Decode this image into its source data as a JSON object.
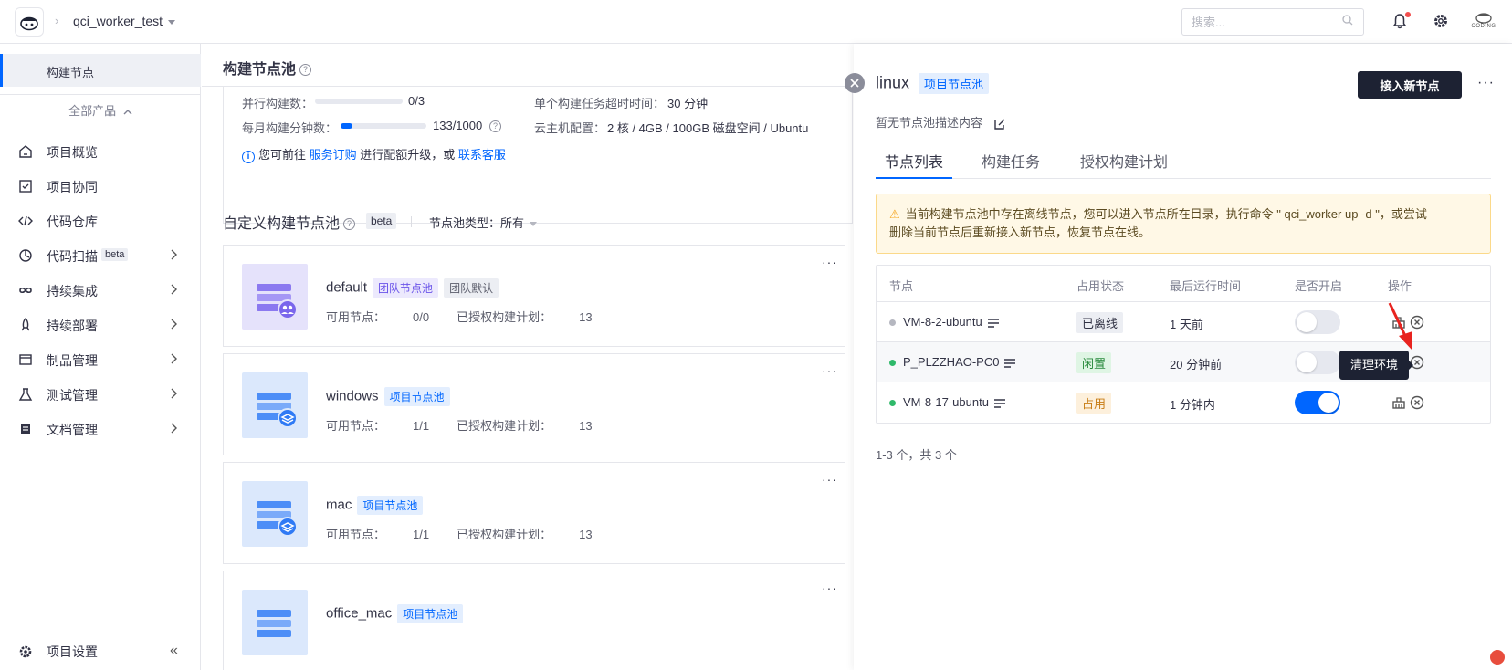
{
  "topbar": {
    "project_name": "qci_worker_test",
    "search_placeholder": "搜索...",
    "brand_text": "CODING"
  },
  "sidebar": {
    "active_item": "构建节点",
    "all_products": "全部产品",
    "items": [
      {
        "label": "项目概览",
        "icon": "home-icon",
        "has_chevron": false
      },
      {
        "label": "项目协同",
        "icon": "checkbox-icon",
        "has_chevron": false
      },
      {
        "label": "代码仓库",
        "icon": "code-icon",
        "has_chevron": false
      },
      {
        "label": "代码扫描",
        "icon": "scan-icon",
        "has_chevron": true,
        "badge": "beta"
      },
      {
        "label": "持续集成",
        "icon": "infinity-icon",
        "has_chevron": true
      },
      {
        "label": "持续部署",
        "icon": "rocket-icon",
        "has_chevron": true
      },
      {
        "label": "制品管理",
        "icon": "box-icon",
        "has_chevron": true
      },
      {
        "label": "测试管理",
        "icon": "flask-icon",
        "has_chevron": true
      },
      {
        "label": "文档管理",
        "icon": "document-icon",
        "has_chevron": true
      }
    ],
    "settings_label": "项目设置",
    "collapse_glyph": "«"
  },
  "main": {
    "title": "构建节点池",
    "stats": {
      "concurrent_label": "并行构建数：",
      "concurrent_value": "0/3",
      "concurrent_fraction": 0,
      "monthly_label": "每月构建分钟数：",
      "monthly_value": "133/1000",
      "monthly_fraction": 0.133,
      "timeout_label": "单个构建任务超时时间：",
      "timeout_value": "30 分钟",
      "cloud_label": "云主机配置：",
      "cloud_value": "2 核 / 4GB / 100GB 磁盘空间 / Ubuntu"
    },
    "info": {
      "prefix": "您可前往 ",
      "link1": "服务订购",
      "middle": " 进行配额升级，或 ",
      "link2": "联系客服"
    },
    "custom": {
      "title": "自定义构建节点池",
      "beta": "beta",
      "filter_label": "节点池类型：",
      "filter_value": "所有"
    },
    "pools": [
      {
        "name": "default",
        "tags": [
          {
            "text": "团队节点池",
            "kind": "team"
          },
          {
            "text": "团队默认",
            "kind": "default"
          }
        ],
        "available_label": "可用节点：",
        "available": "0/0",
        "plans_label": "已授权构建计划：",
        "plans": "13",
        "icon_kind": "team"
      },
      {
        "name": "windows",
        "tags": [
          {
            "text": "项目节点池",
            "kind": "proj"
          }
        ],
        "available_label": "可用节点：",
        "available": "1/1",
        "plans_label": "已授权构建计划：",
        "plans": "13",
        "icon_kind": "proj"
      },
      {
        "name": "mac",
        "tags": [
          {
            "text": "项目节点池",
            "kind": "proj"
          }
        ],
        "available_label": "可用节点：",
        "available": "1/1",
        "plans_label": "已授权构建计划：",
        "plans": "13",
        "icon_kind": "proj"
      },
      {
        "name": "office_mac",
        "tags": [
          {
            "text": "项目节点池",
            "kind": "proj"
          }
        ],
        "available_label": "",
        "available": "",
        "plans_label": "",
        "plans": "",
        "icon_kind": "proj"
      }
    ]
  },
  "drawer": {
    "title": "linux",
    "tag": "项目节点池",
    "primary_button": "接入新节点",
    "description": "暂无节点池描述内容",
    "tabs": [
      "节点列表",
      "构建任务",
      "授权构建计划"
    ],
    "active_tab": 0,
    "warning_line1": "当前构建节点池中存在离线节点，您可以进入节点所在目录，执行命令 \" qci_worker up -d \"，或尝试",
    "warning_line2": "删除当前节点后重新接入新节点，恢复节点在线。",
    "table": {
      "headers": [
        "节点",
        "占用状态",
        "最后运行时间",
        "是否开启",
        "操作"
      ],
      "rows": [
        {
          "node": "VM-8-2-ubuntu",
          "online": false,
          "status": "已离线",
          "status_kind": "off",
          "last_run": "1 天前",
          "enabled": false
        },
        {
          "node": "P_PLZZHAO-PC0",
          "online": true,
          "status": "闲置",
          "status_kind": "idle",
          "last_run": "20 分钟前",
          "enabled": false
        },
        {
          "node": "VM-8-17-ubuntu",
          "online": true,
          "status": "占用",
          "status_kind": "busy",
          "last_run": "1 分钟内",
          "enabled": true
        }
      ]
    },
    "tooltip": "清理环境",
    "pager": "1-3 个，共 3 个"
  },
  "colors": {
    "accent": "#0066ff",
    "online": "#2fb96a",
    "offline": "#b5b7c0",
    "annotation_arrow": "#e8231f"
  }
}
